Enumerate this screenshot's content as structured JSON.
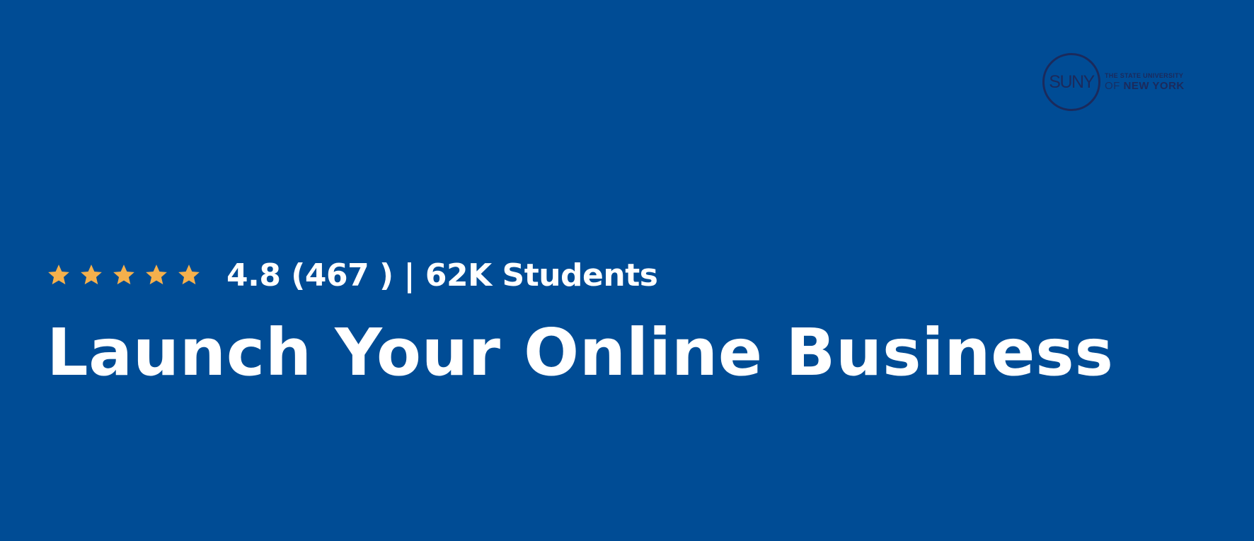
{
  "banner": {
    "background_color": "#004c95",
    "title": "Launch Your Online Business",
    "rating": {
      "stars_filled": 5,
      "stars_total": 5,
      "star_color": "#f5b04c",
      "text": "4.8 (467 ) | 62K Students"
    },
    "logo": {
      "seal_text": "SUNY",
      "line1": "THE STATE UNIVERSITY",
      "line2_prefix": "OF",
      "line2_main": "NEW YORK",
      "color": "#1b2a5c"
    }
  }
}
